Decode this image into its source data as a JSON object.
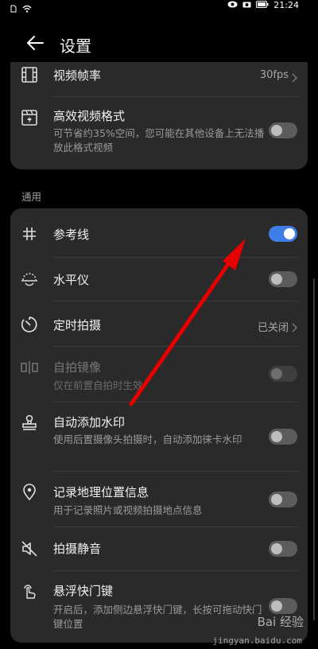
{
  "status": {
    "time": "21:24",
    "left_icons": [
      "sim-icon",
      "wifi-icon"
    ],
    "right_icons": [
      "eye-icon",
      "camera-icon",
      "battery-icon"
    ]
  },
  "header": {
    "title": "设置",
    "back_icon": "back-arrow-icon"
  },
  "video_section": {
    "items": [
      {
        "label": "视频帧率",
        "value": "30fps",
        "icon": "film-icon"
      },
      {
        "label": "高效视频格式",
        "sub": "可节省约35%空间，您可能在其他设备上无法播放此格式视频",
        "icon": "video-format-icon",
        "toggle": "off"
      }
    ]
  },
  "general_section": {
    "title": "通用",
    "items": [
      {
        "label": "参考线",
        "icon": "grid-icon",
        "toggle": "on"
      },
      {
        "label": "水平仪",
        "icon": "level-icon",
        "toggle": "off"
      },
      {
        "label": "定时拍摄",
        "icon": "timer-icon",
        "value": "已关闭"
      },
      {
        "label": "自拍镜像",
        "sub": "仅在前置自拍时生效",
        "icon": "mirror-icon",
        "toggle": "disabled"
      },
      {
        "label": "自动添加水印",
        "sub": "使用后置摄像头拍摄时，自动添加徕卡水印",
        "icon": "stamp-icon",
        "toggle": "off"
      },
      {
        "label": "记录地理位置信息",
        "sub": "用于记录照片或视频拍摄地点信息",
        "icon": "location-icon",
        "toggle": "off"
      },
      {
        "label": "拍摄静音",
        "icon": "mute-icon",
        "toggle": "off"
      },
      {
        "label": "悬浮快门键",
        "sub": "开启后，添加侧边悬浮快门键，长按可拖动快门键位置",
        "icon": "touch-icon",
        "toggle": "off"
      }
    ]
  },
  "watermark": {
    "text": "Bai 经验",
    "url": "jingyan.baidu.com"
  },
  "colors": {
    "background": "#000000",
    "card": "#2a2a2a",
    "toggle_on": "#3f7de8",
    "annotation_arrow": "#e60000"
  }
}
